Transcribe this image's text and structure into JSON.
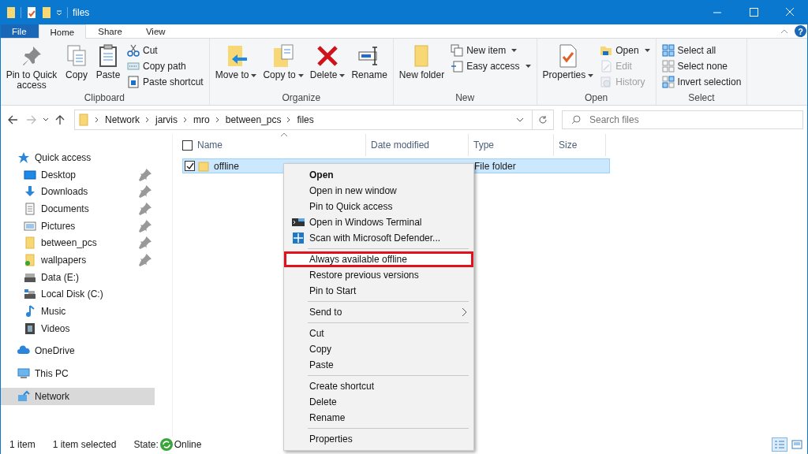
{
  "window": {
    "title": "files"
  },
  "ribbon": {
    "tabs": [
      {
        "label": "File",
        "kind": "file",
        "selected": false
      },
      {
        "label": "Home",
        "kind": "tab",
        "selected": true
      },
      {
        "label": "Share",
        "kind": "tab",
        "selected": false
      },
      {
        "label": "View",
        "kind": "tab",
        "selected": false
      }
    ],
    "help": "?",
    "groups": [
      {
        "label": "Clipboard",
        "items": [
          {
            "label": "Pin to Quick access",
            "kind": "large"
          },
          {
            "label": "Copy",
            "kind": "large"
          },
          {
            "label": "Paste",
            "kind": "large"
          },
          {
            "label": "Cut",
            "kind": "small"
          },
          {
            "label": "Copy path",
            "kind": "small"
          },
          {
            "label": "Paste shortcut",
            "kind": "small"
          }
        ]
      },
      {
        "label": "Organize",
        "items": [
          {
            "label": "Move to",
            "kind": "large",
            "dropdown": true
          },
          {
            "label": "Copy to",
            "kind": "large",
            "dropdown": true
          },
          {
            "label": "Delete",
            "kind": "large",
            "dropdown": true
          },
          {
            "label": "Rename",
            "kind": "large"
          }
        ]
      },
      {
        "label": "New",
        "items": [
          {
            "label": "New folder",
            "kind": "large"
          },
          {
            "label": "New item",
            "kind": "small",
            "dropdown": true
          },
          {
            "label": "Easy access",
            "kind": "small",
            "dropdown": true
          }
        ]
      },
      {
        "label": "Open",
        "items": [
          {
            "label": "Properties",
            "kind": "large",
            "dropdown": true
          },
          {
            "label": "Open",
            "kind": "small",
            "dropdown": true
          },
          {
            "label": "Edit",
            "kind": "small",
            "disabled": true
          },
          {
            "label": "History",
            "kind": "small",
            "disabled": true
          }
        ]
      },
      {
        "label": "Select",
        "items": [
          {
            "label": "Select all",
            "kind": "small"
          },
          {
            "label": "Select none",
            "kind": "small"
          },
          {
            "label": "Invert selection",
            "kind": "small"
          }
        ]
      }
    ]
  },
  "address": {
    "path": [
      "Network",
      "jarvis",
      "mro",
      "between_pcs",
      "files"
    ],
    "search": {
      "placeholder": "Search files"
    }
  },
  "sidebar": {
    "items": [
      {
        "label": "Quick access",
        "selected": false,
        "children": [
          {
            "label": "Desktop",
            "selected": false,
            "pinned": true
          },
          {
            "label": "Downloads",
            "selected": false,
            "pinned": true
          },
          {
            "label": "Documents",
            "selected": false,
            "pinned": true
          },
          {
            "label": "Pictures",
            "selected": false,
            "pinned": true
          },
          {
            "label": "between_pcs",
            "selected": false,
            "pinned": true
          },
          {
            "label": "wallpapers",
            "selected": false,
            "pinned": true
          },
          {
            "label": "Data (E:)",
            "selected": false,
            "pinned": false
          },
          {
            "label": "Local Disk (C:)",
            "selected": false,
            "pinned": false
          },
          {
            "label": "Music",
            "selected": false,
            "pinned": false
          },
          {
            "label": "Videos",
            "selected": false,
            "pinned": false
          }
        ]
      },
      {
        "label": "OneDrive",
        "selected": false
      },
      {
        "label": "This PC",
        "selected": false
      },
      {
        "label": "Network",
        "selected": true
      }
    ]
  },
  "table": {
    "columns": [
      "Name",
      "Date modified",
      "Type",
      "Size"
    ],
    "all_checked": false,
    "rows": [
      {
        "name": "offline",
        "type": "File folder",
        "selected": true,
        "checked": true
      }
    ]
  },
  "context_menu": {
    "sections": [
      [
        {
          "label": "Open",
          "default": true
        },
        {
          "label": "Open in new window"
        },
        {
          "label": "Pin to Quick access"
        },
        {
          "label": "Open in Windows Terminal"
        },
        {
          "label": "Scan with Microsoft Defender..."
        }
      ],
      [
        {
          "label": "Always available offline",
          "highlighted": true
        },
        {
          "label": "Restore previous versions"
        },
        {
          "label": "Pin to Start"
        }
      ],
      [
        {
          "label": "Send to",
          "submenu": true
        }
      ],
      [
        {
          "label": "Cut"
        },
        {
          "label": "Copy"
        },
        {
          "label": "Paste"
        }
      ],
      [
        {
          "label": "Create shortcut"
        },
        {
          "label": "Delete"
        },
        {
          "label": "Rename"
        }
      ],
      [
        {
          "label": "Properties"
        }
      ]
    ]
  },
  "status_bar": {
    "count": "1 item",
    "selection": "1 item selected",
    "state_label": "State:",
    "state": "Online",
    "views": [
      {
        "selected": true
      },
      {
        "selected": false
      }
    ]
  }
}
